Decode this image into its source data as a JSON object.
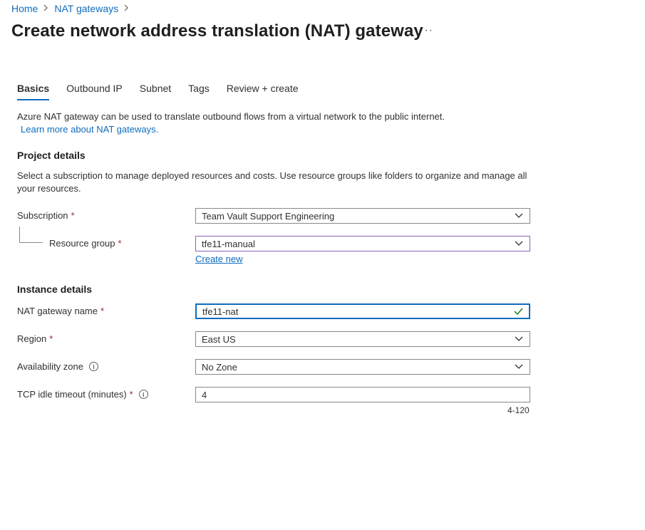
{
  "breadcrumb": {
    "home": "Home",
    "nat_gateways": "NAT gateways"
  },
  "page": {
    "title": "Create network address translation (NAT) gateway",
    "more": "···"
  },
  "tabs": [
    {
      "label": "Basics"
    },
    {
      "label": "Outbound IP"
    },
    {
      "label": "Subnet"
    },
    {
      "label": "Tags"
    },
    {
      "label": "Review + create"
    }
  ],
  "intro": {
    "text": "Azure NAT gateway can be used to translate outbound flows from a virtual network to the public internet.",
    "link": "Learn more about NAT gateways."
  },
  "project": {
    "heading": "Project details",
    "description": "Select a subscription to manage deployed resources and costs. Use resource groups like folders to organize and manage all your resources.",
    "subscription_label": "Subscription",
    "subscription_value": "Team Vault Support Engineering",
    "resource_group_label": "Resource group",
    "resource_group_value": "tfe11-manual",
    "create_new": "Create new"
  },
  "instance": {
    "heading": "Instance details",
    "name_label": "NAT gateway name",
    "name_value": "tfe11-nat",
    "region_label": "Region",
    "region_value": "East US",
    "zone_label": "Availability zone",
    "zone_value": "No Zone",
    "timeout_label": "TCP idle timeout (minutes)",
    "timeout_value": "4",
    "timeout_range": "4-120"
  },
  "required_mark": "*",
  "info_glyph": "i",
  "colors": {
    "accent": "#0f6cbd",
    "required": "#a4262c",
    "focus": "#8764b8",
    "valid": "#107c10"
  }
}
